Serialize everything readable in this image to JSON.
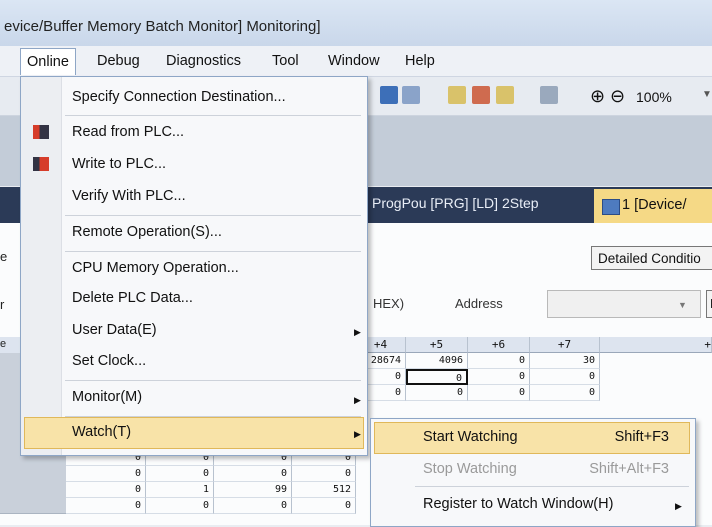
{
  "window": {
    "title": "evice/Buffer Memory Batch Monitor] Monitoring]"
  },
  "menubar": {
    "items": [
      "Online",
      "Debug",
      "Diagnostics",
      "Tool",
      "Window",
      "Help"
    ]
  },
  "toolbar": {
    "zoom": "100%",
    "zoom_in_icon": "zoom-in-icon",
    "zoom_out_icon": "zoom-out-icon"
  },
  "tabs": {
    "progpou": "ProgPou [PRG] [LD] 2Step",
    "device": "1 [Device/"
  },
  "content": {
    "detailed_conditions": "Detailed Conditio",
    "hex_label": "HEX)",
    "address_label": "Address",
    "address_value": "",
    "device_button": "D",
    "edge_e1": "e",
    "edge_r": "r",
    "edge_e2": "e"
  },
  "grid": {
    "headers": [
      "+4",
      "+5",
      "+6",
      "+7",
      "+"
    ],
    "rows": [
      [
        "28674",
        "4096",
        "0",
        "30"
      ],
      [
        "0",
        "0",
        "0",
        "0"
      ],
      [
        "0",
        "0",
        "0",
        "0"
      ]
    ],
    "lower_rows": [
      [
        "0",
        "0",
        "0",
        "0"
      ],
      [
        "0",
        "0",
        "0",
        "0"
      ],
      [
        "0",
        "1",
        "99",
        "512"
      ],
      [
        "0",
        "0",
        "0",
        "0"
      ]
    ]
  },
  "online_menu": {
    "specify_connection": "Specify Connection Destination...",
    "read_from_plc": "Read from PLC...",
    "write_to_plc": "Write to PLC...",
    "verify_with_plc": "Verify With PLC...",
    "remote_operation": "Remote Operation(S)...",
    "cpu_memory_operation": "CPU Memory Operation...",
    "delete_plc_data": "Delete PLC Data...",
    "user_data": "User Data(E)",
    "set_clock": "Set Clock...",
    "monitor": "Monitor(M)",
    "watch": "Watch(T)"
  },
  "watch_submenu": {
    "start_watching": "Start Watching",
    "start_watching_key": "Shift+F3",
    "stop_watching": "Stop Watching",
    "stop_watching_key": "Shift+Alt+F3",
    "register_watch": "Register to Watch Window(H)"
  },
  "colors": {
    "highlight": "#f8e3a8",
    "tab_bar": "#2b3a57",
    "active_tab": "#f5d986"
  }
}
